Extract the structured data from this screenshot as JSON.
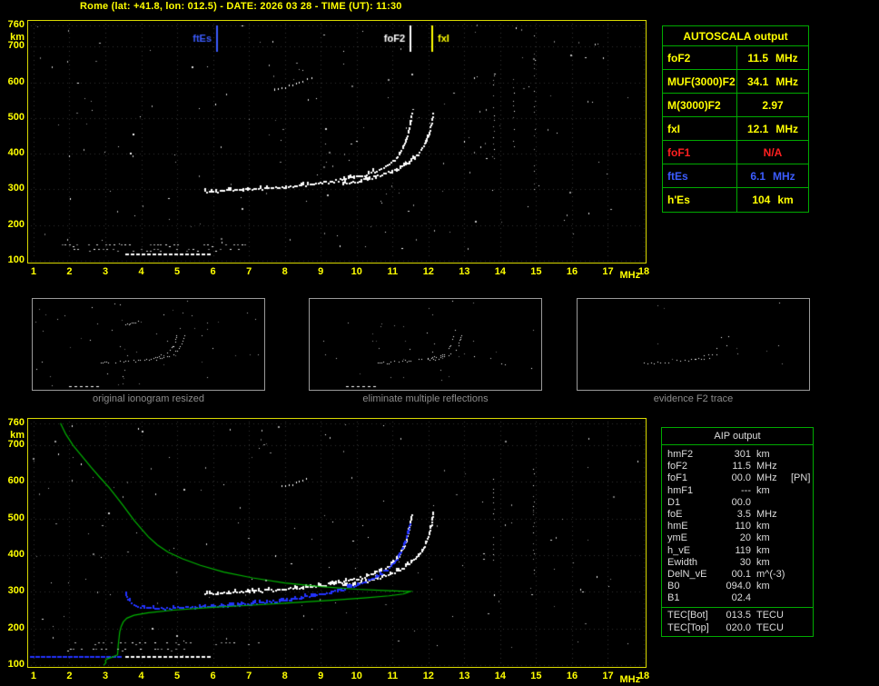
{
  "title": "Rome (lat: +41.8, lon: 012.5) - DATE: 2026 03 28 - TIME (UT): 11:30",
  "colors": {
    "axis_yellow": "#ffff00",
    "plot_border": "#d9d900",
    "table_border": "#00aa00",
    "trace_white": "#ffffff",
    "scaled_trace_blue": "#2233ff",
    "profile_green": "#00b400",
    "fof1_red": "#ff2020",
    "ftes_blue": "#3c5cff",
    "caption_gray": "#8c8c8c"
  },
  "autoscala_table": {
    "title": "AUTOSCALA output",
    "rows": [
      {
        "label": "foF2",
        "value": "11.5",
        "unit": "MHz",
        "color": "#ffff00"
      },
      {
        "label": "MUF(3000)F2",
        "value": "34.1",
        "unit": "MHz",
        "color": "#ffff00"
      },
      {
        "label": "M(3000)F2",
        "value": "2.97",
        "unit": "",
        "color": "#ffff00"
      },
      {
        "label": "fxI",
        "value": "12.1",
        "unit": "MHz",
        "color": "#ffff00"
      },
      {
        "label": "foF1",
        "value": "N/A",
        "unit": "",
        "color": "#ff2020"
      },
      {
        "label": "ftEs",
        "value": "6.1",
        "unit": "MHz",
        "color": "#3c5cff"
      },
      {
        "label": "h'Es",
        "value": "104",
        "unit": "km",
        "color": "#ffff00"
      }
    ]
  },
  "thumbnails": [
    {
      "caption": "original ionogram resized",
      "mode": "all"
    },
    {
      "caption": "eliminate multiple reflections",
      "mode": "no-multiples"
    },
    {
      "caption": "evidence F2 trace",
      "mode": "f2-only"
    }
  ],
  "aip_table": {
    "title": "AIP output",
    "rows": [
      {
        "label": "hmF2",
        "value": "301",
        "unit": "km",
        "extra": ""
      },
      {
        "label": "foF2",
        "value": "11.5",
        "unit": "MHz",
        "extra": ""
      },
      {
        "label": "foF1",
        "value": "00.0",
        "unit": "MHz",
        "extra": "[PN]"
      },
      {
        "label": "hmF1",
        "value": "---",
        "unit": "km",
        "extra": ""
      },
      {
        "label": "D1",
        "value": "00.0",
        "unit": "",
        "extra": ""
      },
      {
        "label": "foE",
        "value": "3.5",
        "unit": "MHz",
        "extra": ""
      },
      {
        "label": "hmE",
        "value": "110",
        "unit": "km",
        "extra": ""
      },
      {
        "label": "ymE",
        "value": "20",
        "unit": "km",
        "extra": ""
      },
      {
        "label": "h_vE",
        "value": "119",
        "unit": "km",
        "extra": ""
      },
      {
        "label": "Ewidth",
        "value": "30",
        "unit": "km",
        "extra": ""
      },
      {
        "label": "DelN_vE",
        "value": "00.1",
        "unit": "m^(-3)",
        "extra": ""
      },
      {
        "label": "B0",
        "value": "094.0",
        "unit": "km",
        "extra": ""
      },
      {
        "label": "B1",
        "value": "02.4",
        "unit": "",
        "extra": ""
      }
    ],
    "footer_rows": [
      {
        "label": "TEC[Bot]",
        "value": "013.5",
        "unit": "TECU",
        "extra": ""
      },
      {
        "label": "TEC[Top]",
        "value": "020.0",
        "unit": "TECU",
        "extra": ""
      }
    ]
  },
  "chart_data": [
    {
      "type": "scatter",
      "name": "ionogram-autoscaled",
      "title": "",
      "xlabel": "MHz",
      "ylabel": "km",
      "xlim": [
        0.85,
        18.05
      ],
      "ylim": [
        95,
        772
      ],
      "x_ticks": [
        1,
        2,
        3,
        4,
        5,
        6,
        7,
        8,
        9,
        10,
        11,
        12,
        13,
        14,
        15,
        16,
        17,
        18
      ],
      "y_ticks": [
        760,
        700,
        600,
        500,
        400,
        300,
        200,
        100
      ],
      "grid": true,
      "markers": [
        {
          "label": "ftEs",
          "freq": 6.1,
          "color": "#3c5cff",
          "side": "left"
        },
        {
          "label": "foF2",
          "freq": 11.5,
          "color": "#ffffff",
          "side": "left"
        },
        {
          "label": "fxI",
          "freq": 12.1,
          "color": "#ffff00",
          "side": "right"
        }
      ],
      "series": [
        {
          "name": "Es-trace",
          "type": "dashes",
          "color": "#ffffff",
          "height_km": 118,
          "f_range": [
            3.55,
            5.95
          ],
          "dash": [
            4,
            6
          ]
        },
        {
          "name": "F2-o-trace",
          "type": "trace",
          "color": "#ffffff",
          "points": [
            [
              5.75,
              295
            ],
            [
              6.3,
              298
            ],
            [
              7.0,
              302
            ],
            [
              7.6,
              306
            ],
            [
              8.2,
              311
            ],
            [
              8.8,
              317
            ],
            [
              9.3,
              324
            ],
            [
              9.8,
              333
            ],
            [
              10.2,
              343
            ],
            [
              10.55,
              355
            ],
            [
              10.85,
              369
            ],
            [
              11.05,
              386
            ],
            [
              11.2,
              405
            ],
            [
              11.32,
              430
            ],
            [
              11.42,
              460
            ],
            [
              11.48,
              490
            ],
            [
              11.52,
              520
            ]
          ]
        },
        {
          "name": "F2-x-trace",
          "type": "trace",
          "color": "#ffffff",
          "points": [
            [
              9.6,
              318
            ],
            [
              10.0,
              325
            ],
            [
              10.4,
              334
            ],
            [
              10.8,
              346
            ],
            [
              11.15,
              360
            ],
            [
              11.45,
              378
            ],
            [
              11.7,
              400
            ],
            [
              11.88,
              428
            ],
            [
              12.0,
              458
            ],
            [
              12.07,
              488
            ],
            [
              12.12,
              518
            ]
          ]
        },
        {
          "name": "second-order-F2",
          "type": "trace",
          "color": "#ffffff",
          "sparse": true,
          "points": [
            [
              7.7,
              582
            ],
            [
              8.1,
              592
            ],
            [
              8.5,
              604
            ],
            [
              8.85,
              618
            ]
          ]
        }
      ],
      "noise": {
        "dots": 170,
        "col_clusters": 3,
        "row_clusters": 2
      }
    },
    {
      "type": "scatter",
      "name": "ionogram-with-profile",
      "title": "",
      "xlabel": "MHz",
      "ylabel": "km",
      "xlim": [
        0.85,
        18.05
      ],
      "ylim": [
        95,
        772
      ],
      "x_ticks": [
        1,
        2,
        3,
        4,
        5,
        6,
        7,
        8,
        9,
        10,
        11,
        12,
        13,
        14,
        15,
        16,
        17,
        18
      ],
      "y_ticks": [
        760,
        700,
        600,
        500,
        400,
        300,
        200,
        100
      ],
      "grid": true,
      "markers": [],
      "series": [
        {
          "name": "Es-trace",
          "type": "dashes",
          "color": "#ffffff",
          "height_km": 122,
          "f_range": [
            3.55,
            5.95
          ],
          "dash": [
            4,
            6
          ]
        },
        {
          "name": "F2-o-trace",
          "type": "trace",
          "color": "#ffffff",
          "points": [
            [
              5.75,
              295
            ],
            [
              6.3,
              298
            ],
            [
              7.0,
              302
            ],
            [
              7.6,
              306
            ],
            [
              8.2,
              311
            ],
            [
              8.8,
              317
            ],
            [
              9.3,
              324
            ],
            [
              9.8,
              333
            ],
            [
              10.2,
              343
            ],
            [
              10.55,
              355
            ],
            [
              10.85,
              369
            ],
            [
              11.05,
              386
            ],
            [
              11.2,
              405
            ],
            [
              11.32,
              430
            ],
            [
              11.42,
              460
            ],
            [
              11.48,
              490
            ],
            [
              11.52,
              520
            ]
          ]
        },
        {
          "name": "F2-x-trace",
          "type": "trace",
          "color": "#ffffff",
          "points": [
            [
              9.6,
              318
            ],
            [
              10.0,
              325
            ],
            [
              10.4,
              334
            ],
            [
              10.8,
              346
            ],
            [
              11.15,
              360
            ],
            [
              11.45,
              378
            ],
            [
              11.7,
              400
            ],
            [
              11.88,
              428
            ],
            [
              12.0,
              458
            ],
            [
              12.07,
              488
            ],
            [
              12.12,
              518
            ]
          ]
        },
        {
          "name": "second-order-F2",
          "type": "trace",
          "color": "#ffffff",
          "sparse": true,
          "points": [
            [
              7.9,
              588
            ],
            [
              8.3,
              600
            ],
            [
              8.7,
              614
            ]
          ]
        },
        {
          "name": "scaled-trace",
          "type": "trace",
          "color": "#2233ff",
          "points": [
            [
              3.55,
              302
            ],
            [
              3.58,
              288
            ],
            [
              3.65,
              275
            ],
            [
              3.78,
              266
            ],
            [
              3.95,
              261
            ],
            [
              4.25,
              258
            ],
            [
              4.65,
              257
            ],
            [
              5.1,
              258
            ],
            [
              5.6,
              260
            ],
            [
              6.1,
              263
            ],
            [
              6.6,
              266
            ],
            [
              7.1,
              270
            ],
            [
              7.6,
              275
            ],
            [
              8.1,
              281
            ],
            [
              8.6,
              288
            ],
            [
              9.1,
              297
            ],
            [
              9.55,
              307
            ],
            [
              9.95,
              319
            ],
            [
              10.3,
              332
            ],
            [
              10.6,
              347
            ],
            [
              10.85,
              364
            ],
            [
              11.05,
              384
            ],
            [
              11.2,
              407
            ],
            [
              11.33,
              435
            ],
            [
              11.42,
              465
            ],
            [
              11.48,
              495
            ]
          ]
        },
        {
          "name": "scaled-E-segment",
          "type": "dashes",
          "color": "#2233ff",
          "height_km": 123,
          "f_range": [
            0.9,
            3.45
          ],
          "dash": [
            5,
            6
          ]
        },
        {
          "name": "electron-density-profile",
          "type": "line",
          "color": "#00b400",
          "points": [
            [
              1.75,
              760
            ],
            [
              1.9,
              730
            ],
            [
              2.1,
              700
            ],
            [
              2.35,
              670
            ],
            [
              2.6,
              640
            ],
            [
              2.85,
              612
            ],
            [
              3.1,
              585
            ],
            [
              3.3,
              560
            ],
            [
              3.5,
              535
            ],
            [
              3.65,
              515
            ],
            [
              3.8,
              495
            ],
            [
              4.0,
              472
            ],
            [
              4.2,
              450
            ],
            [
              4.45,
              428
            ],
            [
              4.75,
              408
            ],
            [
              5.15,
              390
            ],
            [
              5.65,
              372
            ],
            [
              6.3,
              354
            ],
            [
              7.1,
              338
            ],
            [
              8.0,
              324
            ],
            [
              9.0,
              314
            ],
            [
              10.0,
              307
            ],
            [
              10.9,
              303
            ],
            [
              11.5,
              301
            ],
            [
              11.3,
              294
            ],
            [
              10.9,
              289
            ],
            [
              10.2,
              283
            ],
            [
              9.3,
              277
            ],
            [
              8.2,
              270
            ],
            [
              7.0,
              263
            ],
            [
              5.9,
              257
            ],
            [
              4.9,
              250
            ],
            [
              4.2,
              243
            ],
            [
              3.8,
              236
            ],
            [
              3.6,
              228
            ],
            [
              3.5,
              218
            ],
            [
              3.44,
              205
            ],
            [
              3.4,
              190
            ],
            [
              3.38,
              172
            ],
            [
              3.36,
              155
            ],
            [
              3.35,
              140
            ],
            [
              3.34,
              128
            ],
            [
              3.2,
              122
            ],
            [
              3.05,
              117
            ],
            [
              3.0,
              112
            ],
            [
              3.02,
              107
            ],
            [
              2.98,
              102
            ],
            [
              2.95,
              100
            ]
          ]
        }
      ],
      "noise": {
        "dots": 140,
        "col_clusters": 2,
        "row_clusters": 2
      }
    }
  ]
}
